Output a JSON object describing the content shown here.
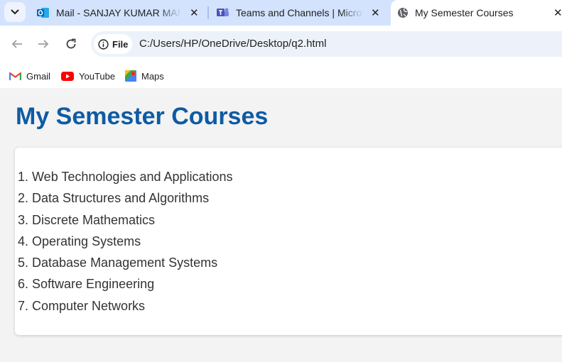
{
  "browser": {
    "tabs": [
      {
        "title": "Mail - SANJAY KUMAR MANDAL",
        "icon": "outlook-icon",
        "close": "✕",
        "active": false
      },
      {
        "title": "Teams and Channels | Microsoft Teams",
        "icon": "teams-icon",
        "close": "✕",
        "active": false
      },
      {
        "title": "My Semester Courses",
        "icon": "globe-icon",
        "close": "✕",
        "active": true
      }
    ],
    "address": {
      "chip_label": "File",
      "url": "C:/Users/HP/OneDrive/Desktop/q2.html"
    },
    "bookmarks": [
      {
        "label": "Gmail",
        "icon": "gmail-icon"
      },
      {
        "label": "YouTube",
        "icon": "youtube-icon"
      },
      {
        "label": "Maps",
        "icon": "maps-icon"
      }
    ]
  },
  "page": {
    "heading": "My Semester Courses",
    "courses": [
      "1. Web Technologies and Applications",
      "2. Data Structures and Algorithms",
      "3. Discrete Mathematics",
      "4. Operating Systems",
      "5. Database Management Systems",
      "6. Software Engineering",
      "7. Computer Networks"
    ]
  },
  "colors": {
    "heading": "#0f5ba3",
    "tabstrip": "#d3e3fd",
    "page_background": "#f3f3f3"
  }
}
